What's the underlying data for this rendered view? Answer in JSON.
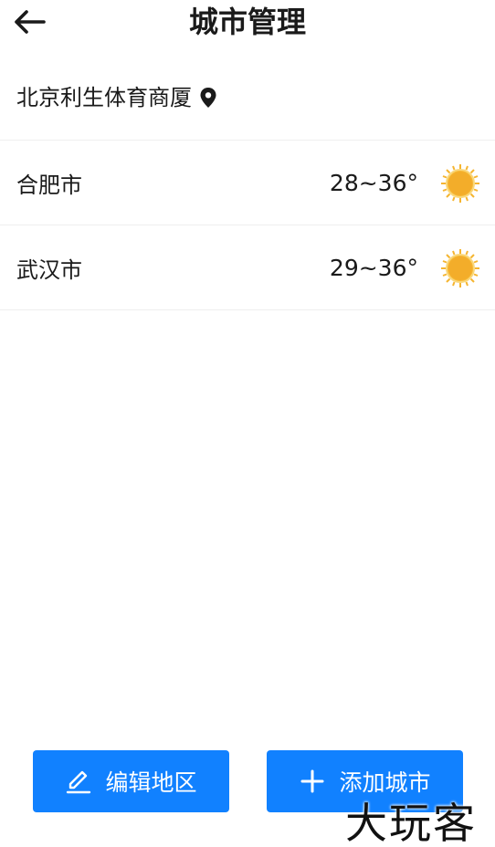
{
  "header": {
    "title": "城市管理"
  },
  "location": {
    "name": "北京利生体育商厦"
  },
  "cities": [
    {
      "name": "合肥市",
      "temp": "28~36°",
      "weather_icon": "sun-icon"
    },
    {
      "name": "武汉市",
      "temp": "29~36°",
      "weather_icon": "sun-icon"
    }
  ],
  "actions": {
    "edit_label": "编辑地区",
    "add_label": "添加城市"
  },
  "watermark": {
    "text": "大玩客"
  },
  "colors": {
    "accent": "#1181ff",
    "sun": "#f5b531",
    "divider": "#efefef"
  }
}
